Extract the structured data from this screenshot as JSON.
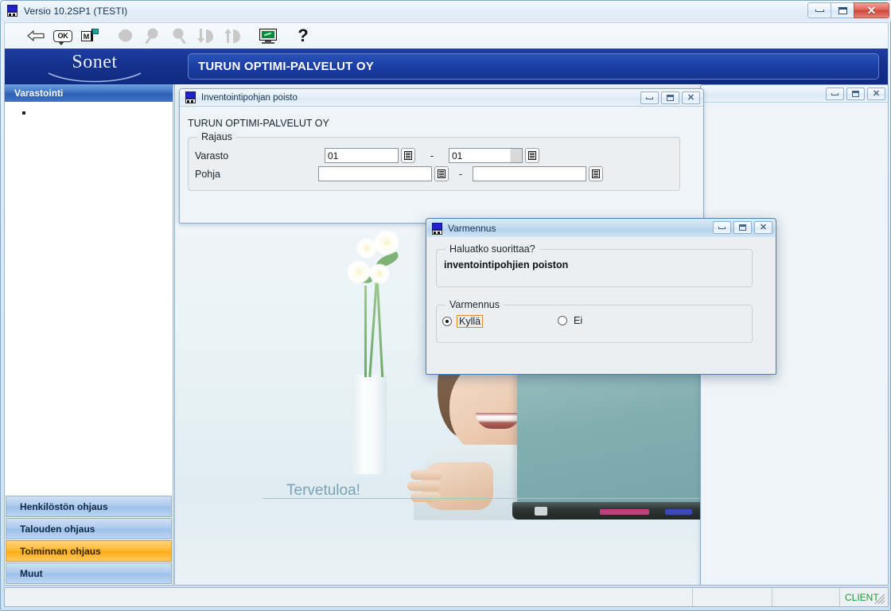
{
  "window": {
    "title": "Versio 10.2SP1 (TESTI)",
    "icon": "sonet-app-icon",
    "controls": {
      "minimize": "minimize-button",
      "maximize": "maximize-button",
      "close": "close-button"
    }
  },
  "toolbar": {
    "items": [
      {
        "name": "back-icon",
        "label": "Takaisin",
        "enabled": true
      },
      {
        "name": "ok-icon",
        "label": "OK",
        "enabled": true
      },
      {
        "name": "mflag-icon",
        "label": "M",
        "enabled": true
      },
      {
        "name": "hand-icon",
        "label": "",
        "enabled": false
      },
      {
        "name": "search-left-icon",
        "label": "",
        "enabled": false
      },
      {
        "name": "search-right-icon",
        "label": "",
        "enabled": false
      },
      {
        "name": "page-down-icon",
        "label": "",
        "enabled": false
      },
      {
        "name": "page-up-icon",
        "label": "",
        "enabled": false
      },
      {
        "name": "monitor-icon",
        "label": "",
        "enabled": true
      },
      {
        "name": "help-icon",
        "label": "?",
        "enabled": true
      }
    ]
  },
  "brand": {
    "logo": "Sonet",
    "company": "TURUN OPTIMI-PALVELUT OY"
  },
  "sidebar": {
    "header": "Varastointi",
    "bullet": "▪",
    "footer_items": [
      {
        "label": "Henkilöstön ohjaus",
        "active": false
      },
      {
        "label": "Talouden ohjaus",
        "active": false
      },
      {
        "label": "Toiminnan ohjaus",
        "active": true
      },
      {
        "label": "Muut",
        "active": false
      }
    ]
  },
  "child_window": {
    "title": "Inventointipohjan poisto",
    "company": "TURUN OPTIMI-PALVELUT OY",
    "group": {
      "legend": "Rajaus",
      "rows": [
        {
          "label": "Varasto",
          "from": "01",
          "to": "01",
          "separator": "-"
        },
        {
          "label": "Pohja",
          "from": "",
          "to": "",
          "separator": "-"
        }
      ]
    }
  },
  "background_window": {
    "title": ""
  },
  "background_image": {
    "welcome": "Tervetuloa!"
  },
  "dialog": {
    "title": "Varmennus",
    "question_group": {
      "legend": "Haluatko suorittaa?",
      "text": "inventointipohjien poiston"
    },
    "confirm_group": {
      "legend": "Varmennus",
      "options": [
        {
          "label": "Kyllä",
          "selected": true,
          "focused": true
        },
        {
          "label": "Ei",
          "selected": false,
          "focused": false
        }
      ]
    }
  },
  "statusbar": {
    "cells": [
      "",
      "",
      "",
      "CLIENT"
    ],
    "client_color": "#1a9b32"
  },
  "colors": {
    "brand_blue": "#16328f",
    "accent_orange": "#ffab12",
    "sidebar_blue": "#3d72c4",
    "status_green": "#1a9b32"
  }
}
